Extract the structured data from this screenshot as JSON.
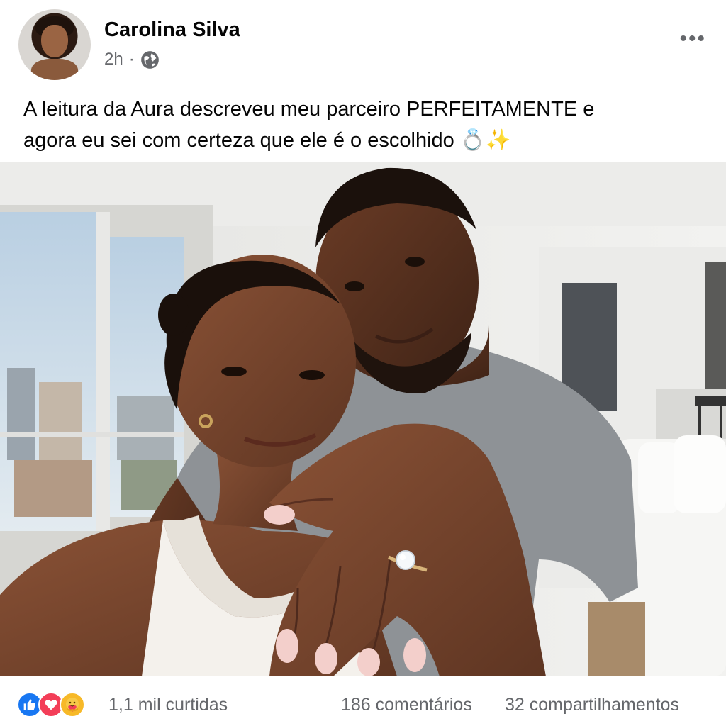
{
  "post": {
    "author": "Carolina Silva",
    "time": "2h",
    "separator": "·",
    "privacy_icon": "globe-icon",
    "more_icon": "more-options-icon",
    "text_line1": "A leitura da Aura descreveu meu parceiro PERFEITAMENTE e",
    "text_line2": "agora eu sei com certeza que ele é o escolhido 💍✨"
  },
  "footer": {
    "reaction_icons": [
      "like-icon",
      "love-icon",
      "care-icon"
    ],
    "likes": "1,1 mil curtidas",
    "comments": "186 comentários",
    "shares": "32 compartilhamentos"
  },
  "colors": {
    "like": "#1877f2",
    "love": "#f33e58",
    "care": "#f7b928",
    "secondary_text": "#65676b"
  }
}
